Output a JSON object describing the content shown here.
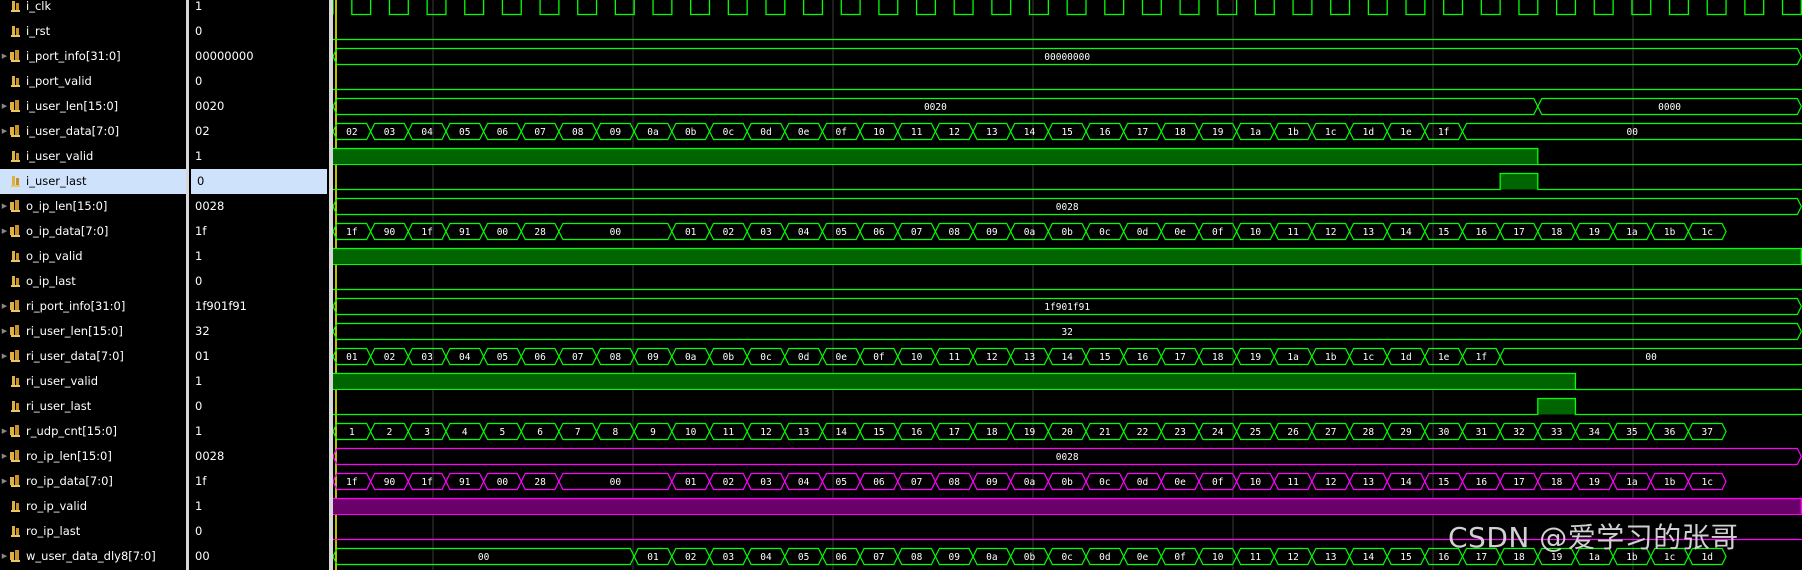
{
  "signals": [
    {
      "name": "i_clk",
      "value": "1",
      "kind": "clk",
      "bus": false,
      "color": "#00ff00"
    },
    {
      "name": "i_rst",
      "value": "0",
      "kind": "const",
      "bus": false,
      "color": "#00ff00",
      "level": 0
    },
    {
      "name": "i_port_info[31:0]",
      "value": "00000000",
      "kind": "bus",
      "bus": true,
      "color": "#00ff00",
      "segments": [
        {
          "v": "00000000",
          "from": 0,
          "to": 39
        }
      ]
    },
    {
      "name": "i_port_valid",
      "value": "0",
      "kind": "const",
      "bus": false,
      "color": "#00ff00",
      "level": 0
    },
    {
      "name": "i_user_len[15:0]",
      "value": "0020",
      "kind": "bus",
      "bus": true,
      "color": "#00ff00",
      "segments": [
        {
          "v": "0020",
          "from": 0,
          "to": 32
        },
        {
          "v": "0000",
          "from": 32,
          "to": 39
        }
      ]
    },
    {
      "name": "i_user_data[7:0]",
      "value": "02",
      "kind": "seq",
      "bus": true,
      "color": "#00ff00",
      "start": 0,
      "seq": [
        "02",
        "03",
        "04",
        "05",
        "06",
        "07",
        "08",
        "09",
        "0a",
        "0b",
        "0c",
        "0d",
        "0e",
        "0f",
        "10",
        "11",
        "12",
        "13",
        "14",
        "15",
        "16",
        "17",
        "18",
        "19",
        "1a",
        "1b",
        "1c",
        "1d",
        "1e",
        "1f"
      ],
      "tail": "00"
    },
    {
      "name": "i_user_valid",
      "value": "1",
      "kind": "highspan",
      "bus": false,
      "color": "#00ff00",
      "from": 0,
      "to": 32
    },
    {
      "name": "i_user_last",
      "value": "0",
      "kind": "pulse",
      "bus": false,
      "color": "#00ff00",
      "from": 31,
      "to": 32,
      "selected": true
    },
    {
      "name": "o_ip_len[15:0]",
      "value": "0028",
      "kind": "bus",
      "bus": true,
      "color": "#00ff00",
      "segments": [
        {
          "v": "0028",
          "from": 0,
          "to": 39
        }
      ]
    },
    {
      "name": "o_ip_data[7:0]",
      "value": "1f",
      "kind": "seq",
      "bus": true,
      "color": "#00ff00",
      "start": 0,
      "seq": [
        "1f",
        "90",
        "1f",
        "91",
        "00",
        "28"
      ],
      "gap": "00",
      "gapLen": 3,
      "seq2": [
        "01",
        "02",
        "03",
        "04",
        "05",
        "06",
        "07",
        "08",
        "09",
        "0a",
        "0b",
        "0c",
        "0d",
        "0e",
        "0f",
        "10",
        "11",
        "12",
        "13",
        "14",
        "15",
        "16",
        "17",
        "18",
        "19",
        "1a",
        "1b",
        "1c"
      ]
    },
    {
      "name": "o_ip_valid",
      "value": "1",
      "kind": "highspan",
      "bus": false,
      "color": "#00ff00",
      "from": 0,
      "to": 39
    },
    {
      "name": "o_ip_last",
      "value": "0",
      "kind": "const",
      "bus": false,
      "color": "#00ff00",
      "level": 0
    },
    {
      "name": "ri_port_info[31:0]",
      "value": "1f901f91",
      "kind": "bus",
      "bus": true,
      "color": "#00ff00",
      "segments": [
        {
          "v": "1f901f91",
          "from": 0,
          "to": 39
        }
      ]
    },
    {
      "name": "ri_user_len[15:0]",
      "value": "32",
      "kind": "bus",
      "bus": true,
      "color": "#00ff00",
      "segments": [
        {
          "v": "32",
          "from": 0,
          "to": 39
        }
      ]
    },
    {
      "name": "ri_user_data[7:0]",
      "value": "01",
      "kind": "seq",
      "bus": true,
      "color": "#00ff00",
      "start": 0,
      "seq": [
        "01",
        "02",
        "03",
        "04",
        "05",
        "06",
        "07",
        "08",
        "09",
        "0a",
        "0b",
        "0c",
        "0d",
        "0e",
        "0f",
        "10",
        "11",
        "12",
        "13",
        "14",
        "15",
        "16",
        "17",
        "18",
        "19",
        "1a",
        "1b",
        "1c",
        "1d",
        "1e",
        "1f"
      ],
      "tail": "00"
    },
    {
      "name": "ri_user_valid",
      "value": "1",
      "kind": "highspan",
      "bus": false,
      "color": "#00ff00",
      "from": 0,
      "to": 33
    },
    {
      "name": "ri_user_last",
      "value": "0",
      "kind": "pulse",
      "bus": false,
      "color": "#00ff00",
      "from": 32,
      "to": 33
    },
    {
      "name": "r_udp_cnt[15:0]",
      "value": "1",
      "kind": "seq",
      "bus": true,
      "color": "#00ff00",
      "start": 0,
      "seq": [
        "1",
        "2",
        "3",
        "4",
        "5",
        "6",
        "7",
        "8",
        "9",
        "10",
        "11",
        "12",
        "13",
        "14",
        "15",
        "16",
        "17",
        "18",
        "19",
        "20",
        "21",
        "22",
        "23",
        "24",
        "25",
        "26",
        "27",
        "28",
        "29",
        "30",
        "31",
        "32",
        "33",
        "34",
        "35",
        "36",
        "37"
      ]
    },
    {
      "name": "ro_ip_len[15:0]",
      "value": "0028",
      "kind": "bus",
      "bus": true,
      "color": "#ff00ff",
      "segments": [
        {
          "v": "0028",
          "from": 0,
          "to": 39
        }
      ]
    },
    {
      "name": "ro_ip_data[7:0]",
      "value": "1f",
      "kind": "seq",
      "bus": true,
      "color": "#ff00ff",
      "start": 0,
      "seq": [
        "1f",
        "90",
        "1f",
        "91",
        "00",
        "28"
      ],
      "gap": "00",
      "gapLen": 3,
      "seq2": [
        "01",
        "02",
        "03",
        "04",
        "05",
        "06",
        "07",
        "08",
        "09",
        "0a",
        "0b",
        "0c",
        "0d",
        "0e",
        "0f",
        "10",
        "11",
        "12",
        "13",
        "14",
        "15",
        "16",
        "17",
        "18",
        "19",
        "1a",
        "1b",
        "1c"
      ]
    },
    {
      "name": "ro_ip_valid",
      "value": "1",
      "kind": "highspan",
      "bus": false,
      "color": "#ff00ff",
      "from": 0,
      "to": 39
    },
    {
      "name": "ro_ip_last",
      "value": "0",
      "kind": "const",
      "bus": false,
      "color": "#ff00ff",
      "level": 0
    },
    {
      "name": "w_user_data_dly8[7:0]",
      "value": "00",
      "kind": "seq",
      "bus": true,
      "color": "#00ff00",
      "start": 0,
      "gap0": "00",
      "gap0Len": 8,
      "seq": [
        "01",
        "02",
        "03",
        "04",
        "05",
        "06",
        "07",
        "08",
        "09",
        "0a",
        "0b",
        "0c",
        "0d",
        "0e",
        "0f",
        "10",
        "11",
        "12",
        "13",
        "14",
        "15",
        "16",
        "17",
        "18",
        "19",
        "1a",
        "1b",
        "1c",
        "1d"
      ]
    }
  ],
  "watermark": "CSDN @爱学习的张哥"
}
